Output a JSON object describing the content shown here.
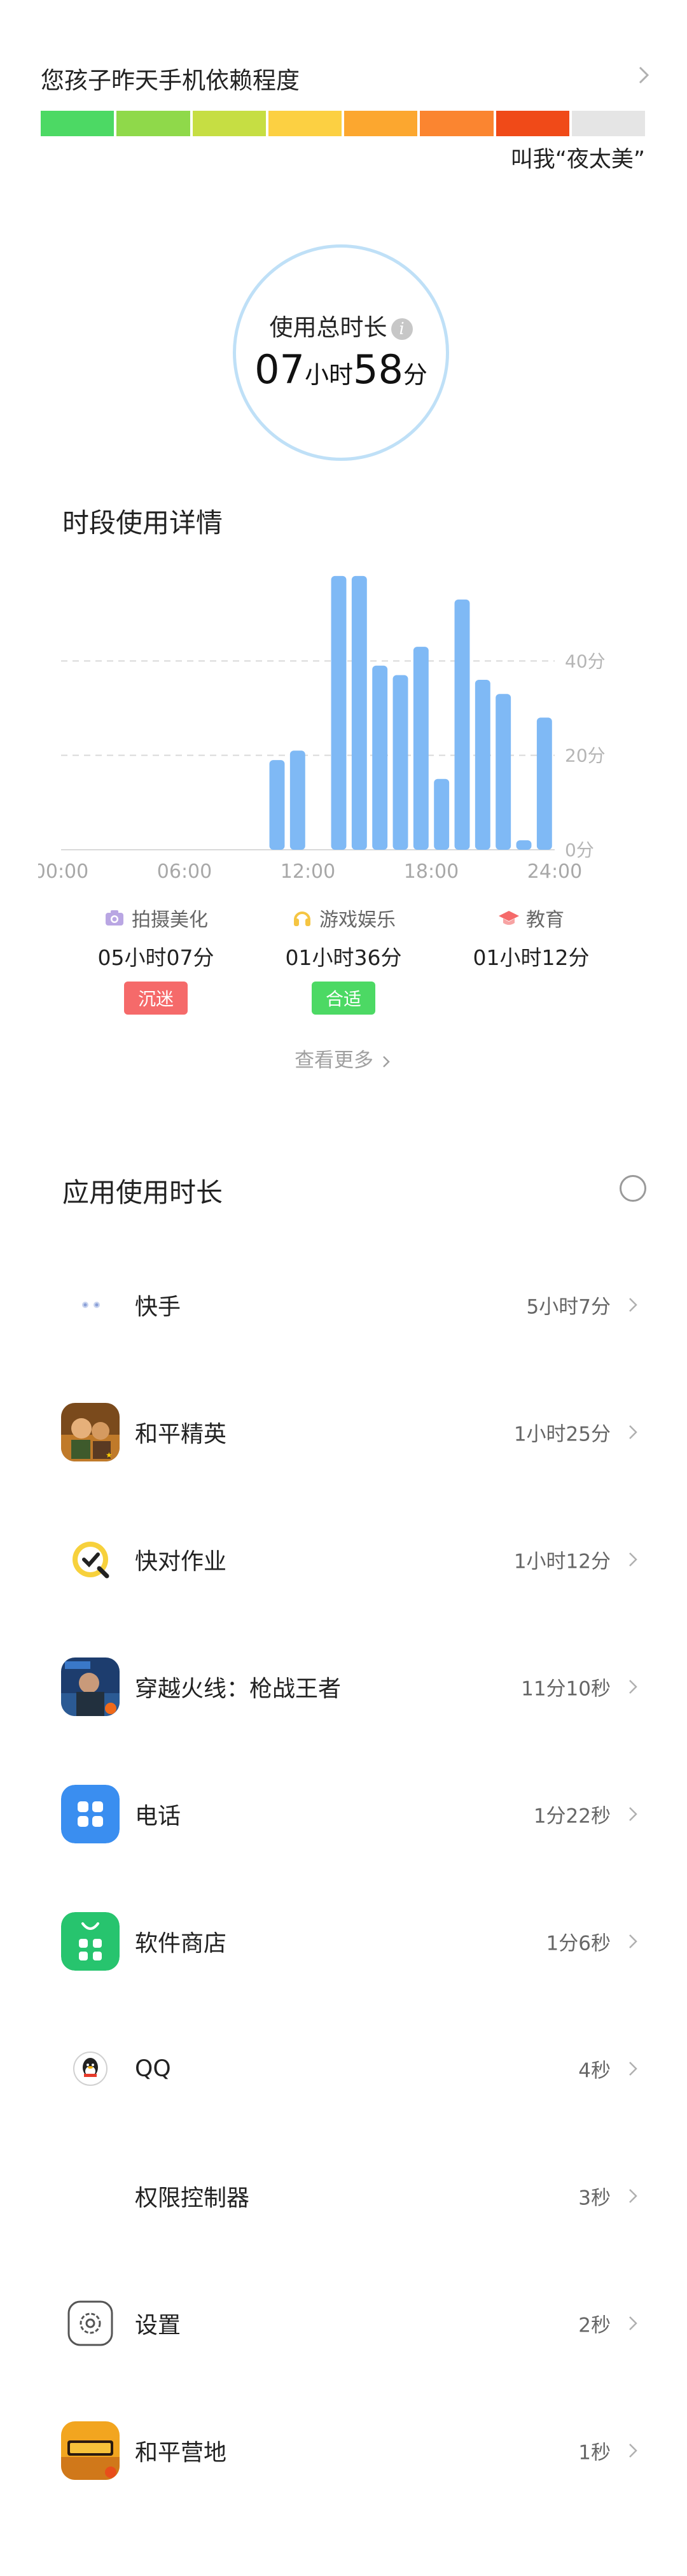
{
  "dependency": {
    "title": "您孩子昨天手机依赖程度",
    "level_text": "叫我“夜太美”",
    "meter_colors": [
      "#4cd964",
      "#8fd94a",
      "#c6de43",
      "#fcd042",
      "#fca72f",
      "#fb8530",
      "#f04a18",
      "#e5e5e5"
    ]
  },
  "total": {
    "label": "使用总时长",
    "info_icon": "i",
    "hours": "07",
    "hours_unit": "小时",
    "minutes": "58",
    "minutes_unit": "分"
  },
  "period_section": {
    "title": "时段使用详情"
  },
  "chart_data": {
    "type": "bar",
    "x_tick_labels": [
      "00:00",
      "06:00",
      "12:00",
      "18:00",
      "24:00"
    ],
    "y_tick_labels": [
      "40分",
      "20分",
      "0分"
    ],
    "ylim": [
      0,
      60
    ],
    "grid": "dashed at 20 and 40",
    "hours": [
      0,
      1,
      2,
      3,
      4,
      5,
      6,
      7,
      8,
      9,
      10,
      11,
      12,
      13,
      14,
      15,
      16,
      17,
      18,
      19,
      20,
      21,
      22,
      23
    ],
    "values": [
      0,
      0,
      0,
      0,
      0,
      0,
      0,
      0,
      0,
      0,
      19,
      21,
      0,
      58,
      58,
      39,
      37,
      43,
      15,
      53,
      36,
      33,
      2,
      28
    ],
    "color": "#7fb9f5"
  },
  "categories": [
    {
      "name": "拍摄美化",
      "time": "05小时07分",
      "badge": "沉迷",
      "badge_color": "#f56a6a",
      "icon": "camera-icon",
      "icon_color": "#a48ad8"
    },
    {
      "name": "游戏娱乐",
      "time": "01小时36分",
      "badge": "合适",
      "badge_color": "#4cd964",
      "icon": "headphones-icon",
      "icon_color": "#f5c542"
    },
    {
      "name": "教育",
      "time": "01小时12分",
      "badge": "",
      "badge_color": "",
      "icon": "graduation-cap-icon",
      "icon_color": "#f56a6a"
    }
  ],
  "see_more": "查看更多",
  "apps_section": {
    "title": "应用使用时长"
  },
  "apps": [
    {
      "name": "快手",
      "duration": "5小时7分",
      "icon": "kuaishou-icon"
    },
    {
      "name": "和平精英",
      "duration": "1小时25分",
      "icon": "peace-elite-icon"
    },
    {
      "name": "快对作业",
      "duration": "1小时12分",
      "icon": "kuaidui-icon"
    },
    {
      "name": "穿越火线：枪战王者",
      "duration": "11分10秒",
      "icon": "crossfire-icon"
    },
    {
      "name": "电话",
      "duration": "1分22秒",
      "icon": "phone-icon"
    },
    {
      "name": "软件商店",
      "duration": "1分6秒",
      "icon": "app-store-icon"
    },
    {
      "name": "QQ",
      "duration": "4秒",
      "icon": "qq-icon"
    },
    {
      "name": "权限控制器",
      "duration": "3秒",
      "icon": ""
    },
    {
      "name": "设置",
      "duration": "2秒",
      "icon": "settings-icon"
    },
    {
      "name": "和平营地",
      "duration": "1秒",
      "icon": "peace-camp-icon"
    }
  ]
}
